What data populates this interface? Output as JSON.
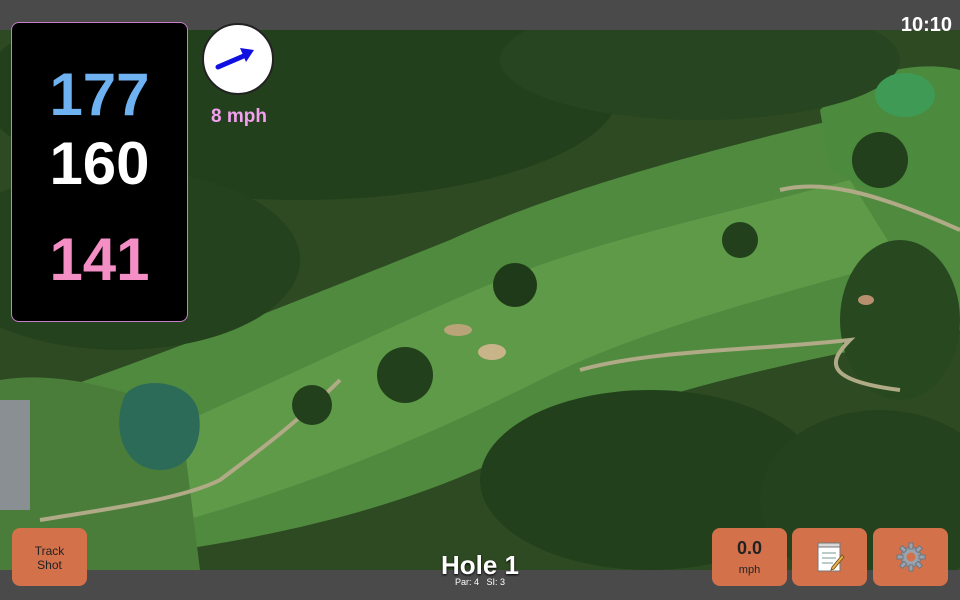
{
  "status": {
    "time": "10:10"
  },
  "distances": {
    "back": "177",
    "middle": "160",
    "front": "141"
  },
  "wind": {
    "speed": "8 mph",
    "arrow_icon": "wind-direction-arrow-icon",
    "arrow_color": "#1010e0"
  },
  "hole": {
    "title": "Hole 1",
    "par_label": "Par: 4",
    "si_label": "SI: 3"
  },
  "buttons": {
    "track_shot_line1": "Track",
    "track_shot_line2": "Shot",
    "speed_value": "0.0",
    "speed_unit": "mph",
    "notes_icon": "notepad-icon",
    "settings_icon": "gear-icon"
  },
  "colors": {
    "button_bg": "#d2714a",
    "back_distance": "#6fb2f2",
    "middle_distance": "#ffffff",
    "front_distance": "#f48fc5",
    "wind_text": "#f4a0f0"
  }
}
